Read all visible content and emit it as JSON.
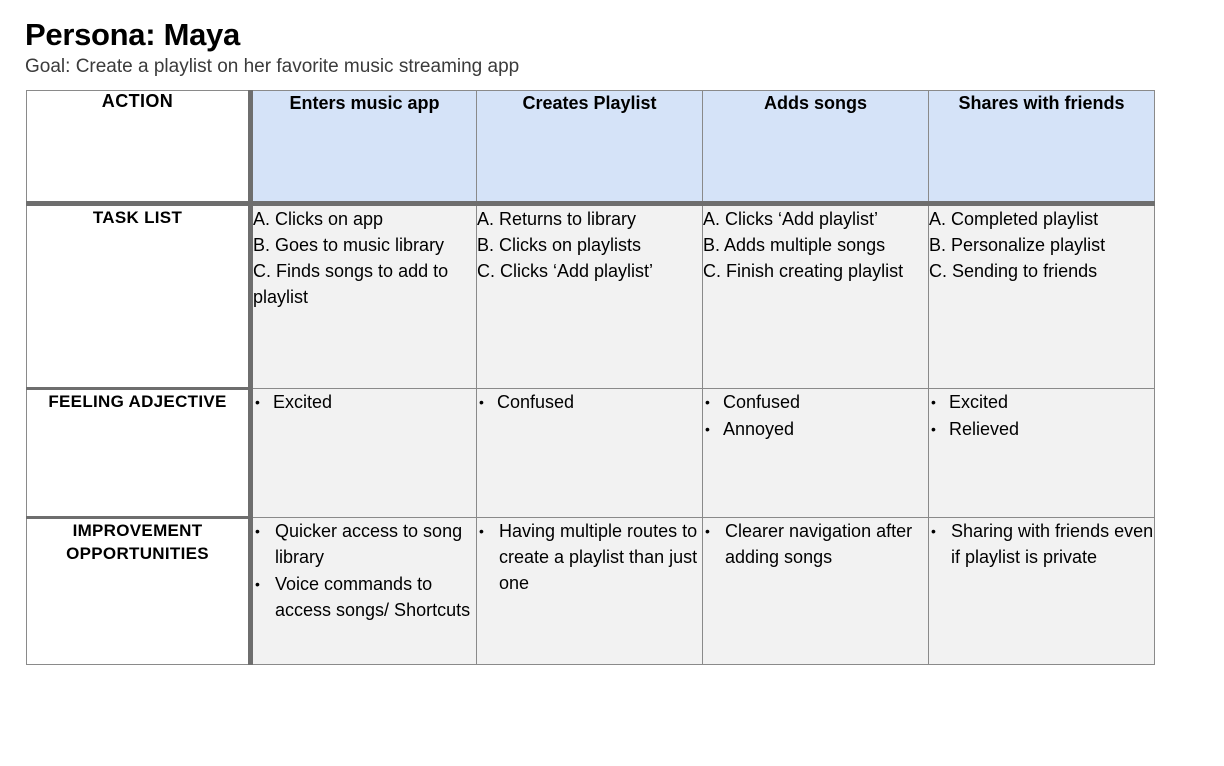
{
  "header": {
    "persona_title": "Persona: Maya",
    "goal": "Goal: Create a playlist on her favorite music streaming app"
  },
  "colors": {
    "stage_header_bg": "#d5e3f8",
    "cell_bg": "#f2f2f2",
    "label_bg": "#ffffff",
    "thick_border": "#6e6e6e",
    "thin_border": "#8a8a8a",
    "text": "#000000",
    "goal_text": "#3b3b3b"
  },
  "table": {
    "row_labels": {
      "action": "ACTION",
      "task_list": "TASK LIST",
      "feeling_adjective": "FEELING ADJECTIVE",
      "improvement_opportunities": "IMPROVEMENT OPPORTUNITIES"
    },
    "stages": [
      "Enters music app",
      "Creates Playlist",
      "Adds songs",
      "Shares with friends"
    ],
    "task_list": [
      {
        "stage": "Enters music app",
        "steps": [
          "A. Clicks on app",
          "B. Goes to music library",
          "C. Finds songs to add to playlist"
        ]
      },
      {
        "stage": "Creates Playlist",
        "steps": [
          "A. Returns to library",
          "B. Clicks on playlists",
          "C. Clicks ‘Add playlist’"
        ]
      },
      {
        "stage": "Adds songs",
        "steps": [
          "A. Clicks ‘Add playlist’",
          "B. Adds multiple songs",
          "C. Finish creating playlist"
        ]
      },
      {
        "stage": "Shares with friends",
        "steps": [
          "A. Completed playlist",
          "B. Personalize playlist",
          "C. Sending to friends"
        ]
      }
    ],
    "feeling_adjective": [
      {
        "stage": "Enters music app",
        "items": [
          "Excited"
        ]
      },
      {
        "stage": "Creates Playlist",
        "items": [
          "Confused"
        ]
      },
      {
        "stage": "Adds songs",
        "items": [
          "Confused",
          "Annoyed"
        ]
      },
      {
        "stage": "Shares with friends",
        "items": [
          "Excited",
          "Relieved"
        ]
      }
    ],
    "improvement_opportunities": [
      {
        "stage": "Enters music app",
        "items": [
          "Quicker access to song library",
          "Voice commands to access songs/ Shortcuts"
        ]
      },
      {
        "stage": "Creates Playlist",
        "items": [
          "Having multiple routes to create a playlist than just one"
        ]
      },
      {
        "stage": "Adds songs",
        "items": [
          "Clearer navigation after adding songs"
        ]
      },
      {
        "stage": "Shares with friends",
        "items": [
          "Sharing with friends even if playlist is private"
        ]
      }
    ]
  }
}
